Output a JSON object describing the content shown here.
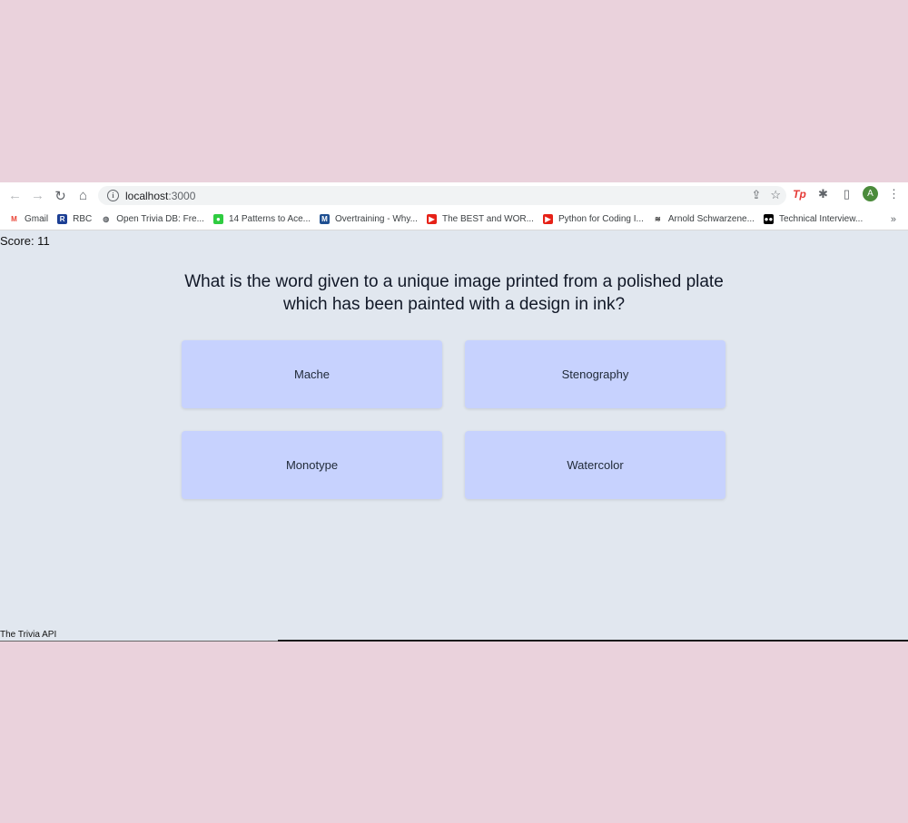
{
  "browser": {
    "url_host": "localhost",
    "url_port": ":3000",
    "avatar_letter": "A",
    "bookmarks": [
      {
        "label": "Gmail",
        "icon": "gmail-icon",
        "color": "#ea4335",
        "glyph": "M"
      },
      {
        "label": "RBC",
        "icon": "rbc-icon",
        "color": "#1c3f94",
        "glyph": "R"
      },
      {
        "label": "Open Trivia DB: Fre...",
        "icon": "globe-icon",
        "color": "#5f6368",
        "glyph": "◍"
      },
      {
        "label": "14 Patterns to Ace...",
        "icon": "patterns-icon",
        "color": "#2ecc40",
        "glyph": "●"
      },
      {
        "label": "Overtraining - Why...",
        "icon": "overtraining-icon",
        "color": "#1e4f91",
        "glyph": "M"
      },
      {
        "label": "The BEST and WOR...",
        "icon": "youtube-icon",
        "color": "#e62117",
        "glyph": "▶"
      },
      {
        "label": "Python for Coding I...",
        "icon": "youtube-icon",
        "color": "#e62117",
        "glyph": "▶"
      },
      {
        "label": "Arnold Schwarzene...",
        "icon": "waves-icon",
        "color": "#333333",
        "glyph": "≋"
      },
      {
        "label": "Technical Interview...",
        "icon": "medium-icon",
        "color": "#000000",
        "glyph": "●●"
      }
    ],
    "more_label": "»"
  },
  "page": {
    "score": "Score: 11",
    "question": "What is the word given to a unique image printed from a polished plate which has been painted with a design in ink?",
    "answers": [
      "Mache",
      "Stenography",
      "Monotype",
      "Watercolor"
    ],
    "footer": "The Trivia API"
  },
  "colors": {
    "outer_background": "#ead2dc",
    "page_background": "#e1e7ef",
    "answer_background": "#c7d2fe"
  }
}
